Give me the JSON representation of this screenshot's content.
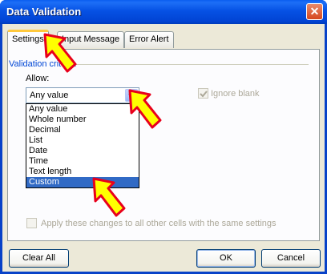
{
  "window": {
    "title": "Data Validation",
    "close_symbol": "✕"
  },
  "tabs": [
    {
      "label": "Settings",
      "active": true
    },
    {
      "label": "Input Message",
      "active": false
    },
    {
      "label": "Error Alert",
      "active": false
    }
  ],
  "group": {
    "label": "Validation criteria"
  },
  "allow": {
    "label": "Allow:",
    "value": "Any value",
    "options": [
      "Any value",
      "Whole number",
      "Decimal",
      "List",
      "Date",
      "Time",
      "Text length",
      "Custom"
    ],
    "highlighted": "Custom"
  },
  "ignore_blank": {
    "label": "Ignore blank",
    "checked": true,
    "enabled": false
  },
  "apply_all": {
    "label": "Apply these changes to all other cells with the same settings",
    "checked": false,
    "enabled": false
  },
  "buttons": {
    "clear": "Clear All",
    "ok": "OK",
    "cancel": "Cancel"
  },
  "colors": {
    "title_bar": "#0651e4",
    "tab_highlight": "#ffc83c",
    "group_label": "#0046d5",
    "selection": "#316ac5",
    "annotation_arrow": "#ffff00",
    "annotation_outline": "#e8001c"
  },
  "annotations": [
    {
      "icon": "arrow-pointer-icon",
      "target": "tab-settings"
    },
    {
      "icon": "arrow-pointer-icon",
      "target": "allow-dropdown-button"
    },
    {
      "icon": "arrow-pointer-icon",
      "target": "dropdown-option-custom"
    }
  ]
}
